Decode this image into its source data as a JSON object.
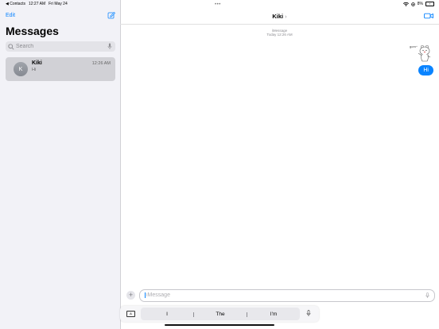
{
  "status_bar": {
    "back_app": "Contacts",
    "time": "12:27 AM",
    "date": "Fri May 24",
    "battery_percent": "8%"
  },
  "sidebar": {
    "edit_label": "Edit",
    "title": "Messages",
    "search": {
      "placeholder": "Search"
    },
    "conversations": [
      {
        "avatar_initial": "K",
        "name": "Kiki",
        "time": "12:26 AM",
        "preview": "Hi"
      }
    ]
  },
  "conversation": {
    "contact_name": "Kiki",
    "service_label": "iMessage",
    "timestamp": "Today 12:26 AM",
    "sticker_caption": "gom",
    "messages": [
      {
        "from": "me",
        "text": "Hi"
      }
    ],
    "compose": {
      "placeholder": "iMessage"
    }
  },
  "keyboard_bar": {
    "mode_label": "A",
    "suggestions": [
      "I",
      "The",
      "I'm"
    ]
  },
  "colors": {
    "accent": "#0a84ff",
    "sidebar_bg": "#f2f2f7",
    "selected_row": "#d1d1d6"
  }
}
